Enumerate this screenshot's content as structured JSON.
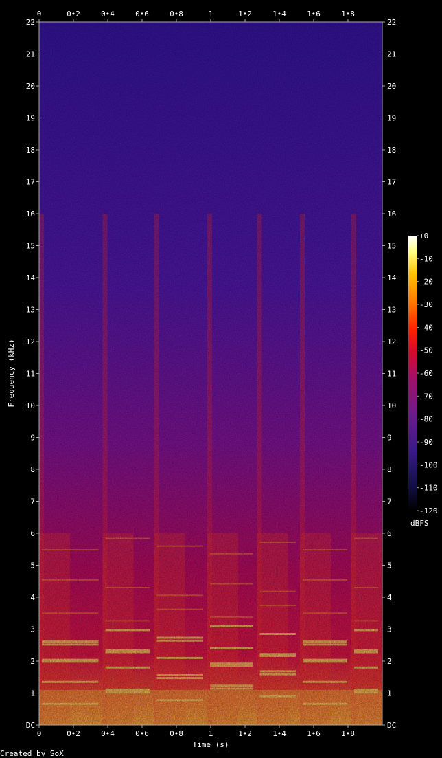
{
  "chart_data": {
    "type": "heatmap",
    "xlabel": "Time (s)",
    "ylabel": "Frequency (kHz)",
    "x_ticks": [
      "0",
      "0•2",
      "0•4",
      "0•6",
      "0•8",
      "1",
      "1•2",
      "1•4",
      "1•6",
      "1•8"
    ],
    "x_tick_values": [
      0,
      0.2,
      0.4,
      0.6,
      0.8,
      1.0,
      1.2,
      1.4,
      1.6,
      1.8
    ],
    "xlim": [
      0,
      2.0
    ],
    "y_ticks": [
      "DC",
      "1",
      "2",
      "3",
      "4",
      "5",
      "6",
      "7",
      "8",
      "9",
      "10",
      "11",
      "12",
      "13",
      "14",
      "15",
      "16",
      "17",
      "18",
      "19",
      "20",
      "21",
      "22"
    ],
    "y_tick_values": [
      0,
      1,
      2,
      3,
      4,
      5,
      6,
      7,
      8,
      9,
      10,
      11,
      12,
      13,
      14,
      15,
      16,
      17,
      18,
      19,
      20,
      21,
      22
    ],
    "ylim": [
      0,
      22
    ],
    "colorbar": {
      "label": "dBFS",
      "ticks": [
        "+0",
        "-10",
        "-20",
        "-30",
        "-40",
        "-50",
        "-60",
        "-70",
        "-80",
        "-90",
        "-100",
        "-110",
        "-120"
      ],
      "tick_values": [
        0,
        -10,
        -20,
        -30,
        -40,
        -50,
        -60,
        -70,
        -80,
        -90,
        -100,
        -110,
        -120
      ],
      "range": [
        -120,
        0
      ]
    },
    "onsets_s": [
      0.0,
      0.37,
      0.67,
      0.98,
      1.27,
      1.52,
      1.82
    ],
    "harmonic_lines_khz": [
      0.9,
      1.35,
      1.8,
      2.1,
      2.4,
      2.85,
      3.5,
      4.3,
      5.6
    ],
    "colors": {
      "background": "#000000",
      "axis": "#aaaaaa",
      "text": "#ffffff",
      "scale": [
        "#000000",
        "#14104d",
        "#3a1a8a",
        "#6e1a8c",
        "#a0106a",
        "#d80a2a",
        "#ff2200",
        "#ff7a00",
        "#ffc000",
        "#ffff80",
        "#ffffff"
      ]
    }
  },
  "footer": {
    "credit": "Created by SoX"
  }
}
